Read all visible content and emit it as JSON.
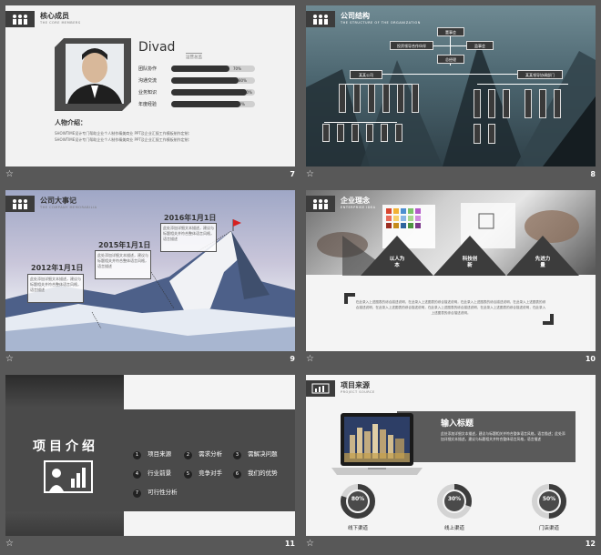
{
  "slides": {
    "s7": {
      "title": "核心成员",
      "subtitle": "THE CORE MEMBERS",
      "name": "Divad",
      "role": "运营总监",
      "skills": [
        {
          "label": "团队协作",
          "value": "70%",
          "pct": 0.7
        },
        {
          "label": "沟通交流",
          "value": "80%",
          "pct": 0.8
        },
        {
          "label": "业务知识",
          "value": "90%",
          "pct": 0.9
        },
        {
          "label": "年度经验",
          "value": "83%",
          "pct": 0.83
        }
      ],
      "intro_title": "人物介绍：",
      "intro_lines": [
        "SHOWTIME设计专门帮助企业个人制作精美商业 PPT及企业汇报工作模板制作定制：",
        "SHOWTIME设计专门帮助企业个人制作精美商业 PPT及企业汇报工作模板制作定制："
      ],
      "number": "7"
    },
    "s8": {
      "title": "公司结构",
      "subtitle": "THE STRUCTURE OF THE ORGANIZATION",
      "top": "董事会",
      "left_branch": "投资领导合作伙伴",
      "right_branch": "监事会",
      "ceo": "总经理",
      "dept_left": "某某公司",
      "dept_right": "某某领导协调部门",
      "number": "8"
    },
    "s9": {
      "title": "公司大事记",
      "subtitle": "THE COMPANY MEMORABILIA",
      "events": [
        {
          "date": "2012年1月1日",
          "text": "此处添加详细文本描述，建议与标题相关并符合整体语言风格，语言描述"
        },
        {
          "date": "2015年1月1日",
          "text": "此处添加详细文本描述，建议与标题相关并符合整体语言风格，语言描述"
        },
        {
          "date": "2016年1月1日",
          "text": "此处添加详细文本描述，建议与标题相关并符合整体语言风格，语言描述"
        }
      ],
      "number": "9"
    },
    "s10": {
      "title": "企业理念",
      "subtitle": "ENTERPRISE IDEA",
      "triangles": [
        "以人为本",
        "科技创新",
        "先进力量"
      ],
      "body": "在此录入上述图表的综合描述说明，在此录入上述图表的综合描述说明，在此录入上述图表的综合描述说明，在此录入上述图表的综合描述说明，在此录入上述图表的综合描述说明，在此录入上述图表的综合描述说明，在此录入上述图表的综合描述说明，在此录入上述图表的综合描述说明。",
      "number": "10"
    },
    "s11": {
      "title": "项目介绍",
      "items": [
        {
          "n": "1",
          "label": "项目来源"
        },
        {
          "n": "2",
          "label": "需求分析"
        },
        {
          "n": "3",
          "label": "需解决问题"
        },
        {
          "n": "4",
          "label": "行业前景"
        },
        {
          "n": "5",
          "label": "竞争对手"
        },
        {
          "n": "6",
          "label": "我们的优势"
        },
        {
          "n": "7",
          "label": "可行性分析"
        }
      ],
      "number": "11"
    },
    "s12": {
      "title": "项目来源",
      "subtitle": "PROJECT SOURCE",
      "input_title": "输入标题",
      "body": "此处添加详细文本描述，建议与标题相关并符合整体语言风格，语言描述；此处添加详细文本描述，建议与标题相关并符合整体语言风格，语言描述",
      "rings": [
        {
          "value": "80%",
          "pct": 0.8,
          "label": "线下渠道"
        },
        {
          "value": "30%",
          "pct": 0.3,
          "label": "线上渠道"
        },
        {
          "value": "50%",
          "pct": 0.5,
          "label": "门店渠道"
        }
      ],
      "number": "12"
    }
  }
}
